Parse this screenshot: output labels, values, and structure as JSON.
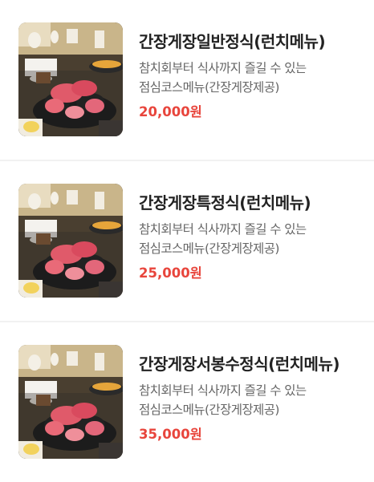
{
  "menu": {
    "items": [
      {
        "name": "간장게장일반정식(런치메뉴)",
        "description": "참치회부터 식사까지 즐길 수 있는 점심코스메뉴(간장게장제공)",
        "price": "20,000원"
      },
      {
        "name": "간장게장특정식(런치메뉴)",
        "description": "참치회부터 식사까지 즐길 수 있는 점심코스메뉴(간장게장제공)",
        "price": "25,000원"
      },
      {
        "name": "간장게장서봉수정식(런치메뉴)",
        "description": "참치회부터 식사까지 즐길 수 있는 점심코스메뉴(간장게장제공)",
        "price": "35,000원"
      }
    ]
  },
  "colors": {
    "price": "#e8453c",
    "name": "#222222",
    "description": "#666666",
    "divider": "#f1f1f1"
  }
}
